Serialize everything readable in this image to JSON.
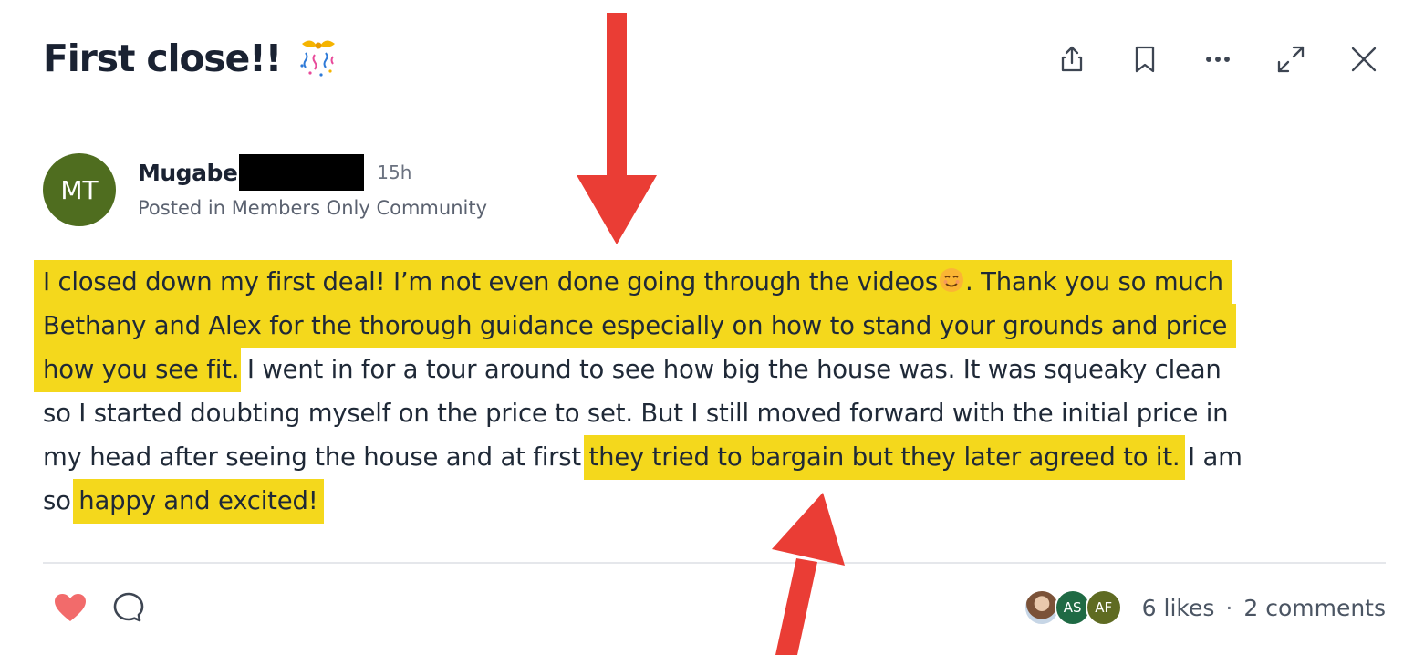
{
  "post": {
    "title": "First close!!",
    "title_emoji": "confetti-emoji",
    "author": {
      "initials": "MT",
      "name": "Mugabe",
      "name_redacted": true,
      "avatar_color": "#4f6d1f",
      "time_ago": "15h"
    },
    "posted_in_prefix": "Posted in ",
    "space_name": "Members Only Community",
    "body_lines": {
      "l1a": "I closed down my first deal! I’m not even done going through the videos",
      "l1b": ". Thank you so much",
      "l2": "Bethany and Alex for the thorough guidance especially on how to stand your grounds and price",
      "l3a": "how you see fit",
      "l3b": ". I went in for a tour around to see how big the house was. It was squeaky clean",
      "l4": "so I started doubting myself on the price to set. But I still moved forward with the initial price in",
      "l5a": "my head after seeing the house and at first ",
      "l5b": "they tried to bargain but they later agreed to it.",
      "l5c": " I am",
      "l6a": "so ",
      "l6b": "happy and excited!"
    },
    "highlight_color": "#f4d81c"
  },
  "header_actions": [
    "share-icon",
    "bookmark-icon",
    "more-icon",
    "expand-icon",
    "close-icon"
  ],
  "reactions": {
    "like_color": "#f26b6b",
    "liker_avatars": [
      {
        "label": "",
        "kind": "photo"
      },
      {
        "label": "AS",
        "color": "#1f6a44"
      },
      {
        "label": "AF",
        "color": "#5f6b22"
      }
    ],
    "likes_text": "6 likes",
    "separator": "·",
    "comments_text": "2 comments"
  },
  "annotation_color": "#ea3d35"
}
